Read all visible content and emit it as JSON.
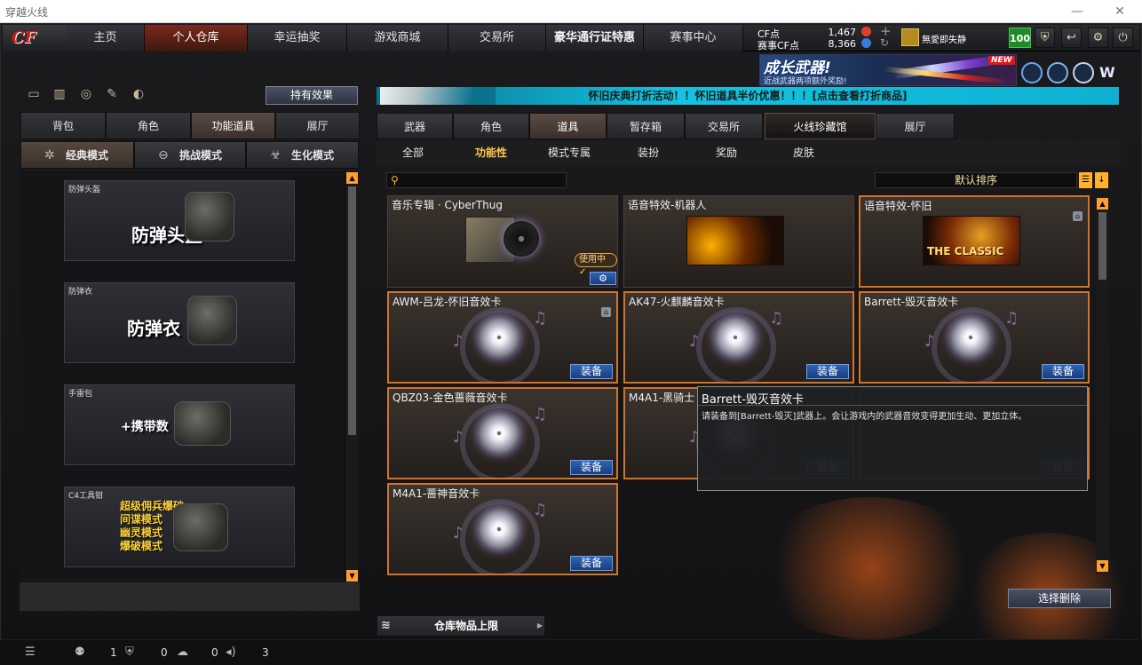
{
  "window": {
    "title": "穿越火线",
    "min": "—",
    "max": "☐",
    "close": "✕"
  },
  "nav": {
    "logo": "CF",
    "tabs": [
      "主页",
      "个人仓库",
      "幸运抽奖",
      "游戏商城",
      "交易所",
      "豪华通行证特惠",
      "赛事中心"
    ],
    "active_tab": "个人仓库"
  },
  "currency": {
    "cf_label": "CF点",
    "cf_value": "1,467",
    "match_label": "赛事CF点",
    "match_value": "8,366"
  },
  "player": {
    "name": "無愛即失静",
    "level": "100"
  },
  "ad": {
    "headline": "成长武器!",
    "sub": "近战武器两项额外奖励!",
    "badge": "NEW"
  },
  "announcement": "怀旧庆典打折活动！！怀旧道具半价优惠！！！[点击查看打折商品]",
  "left": {
    "effect_button": "持有效果",
    "tabs": [
      "背包",
      "角色",
      "功能道具",
      "展厅"
    ],
    "active_tab": "功能道具",
    "modes": [
      "经典模式",
      "挑战模式",
      "生化模式"
    ],
    "active_mode": "经典模式",
    "items": [
      {
        "caption": "防弹头盔",
        "text": "防弹头盔"
      },
      {
        "caption": "防弹衣",
        "text": "防弹衣"
      },
      {
        "caption": "手雷包",
        "text": "+携带数"
      },
      {
        "caption": "C4工具钳",
        "lines": [
          "超级佣兵爆破",
          "间谍模式",
          "幽灵模式",
          "爆破模式"
        ]
      }
    ]
  },
  "right": {
    "tabs": [
      "武器",
      "角色",
      "道具",
      "暂存箱",
      "交易所",
      "火线珍藏馆",
      "展厅"
    ],
    "active_tab": "道具",
    "subtabs": [
      "全部",
      "功能性",
      "模式专属",
      "装扮",
      "奖励",
      "皮肤"
    ],
    "active_subtab": "功能性",
    "sort_label": "默认排序",
    "cards": [
      {
        "name": "音乐专辑 · CyberThug",
        "status": "使用中✓"
      },
      {
        "name": "语音特效-机器人"
      },
      {
        "name": "语音特效-怀旧",
        "art_text": "THE CLASSIC"
      },
      {
        "name": "AWM-吕龙-怀旧音效卡",
        "button": "装备"
      },
      {
        "name": "AK47-火麒麟音效卡",
        "button": "装备"
      },
      {
        "name": "Barrett-毁灭音效卡",
        "button": "装备"
      },
      {
        "name": "QBZ03-金色蔷薇音效卡",
        "button": "装备"
      },
      {
        "name": "M4A1-黑骑士",
        "button": "装备"
      },
      {
        "name": "",
        "button": "装备"
      },
      {
        "name": "M4A1-蔷神音效卡",
        "button": "装备"
      }
    ],
    "tooltip": {
      "title": "Barrett-毁灭音效卡",
      "desc": "请装备到[Barrett-毁灭]武器上。会让游戏内的武器音效变得更加生动、更加立体。"
    },
    "delete_button": "选择删除",
    "capacity_label": "仓库物品上限"
  },
  "status": {
    "friends": "1",
    "shield": "0",
    "chat": "0",
    "sound": "3"
  },
  "colors": {
    "accent": "#ffb02c",
    "equip_blue": "#2f63b6",
    "orange_border": "#d2732a",
    "announce_cyan": "#12c4e2"
  }
}
